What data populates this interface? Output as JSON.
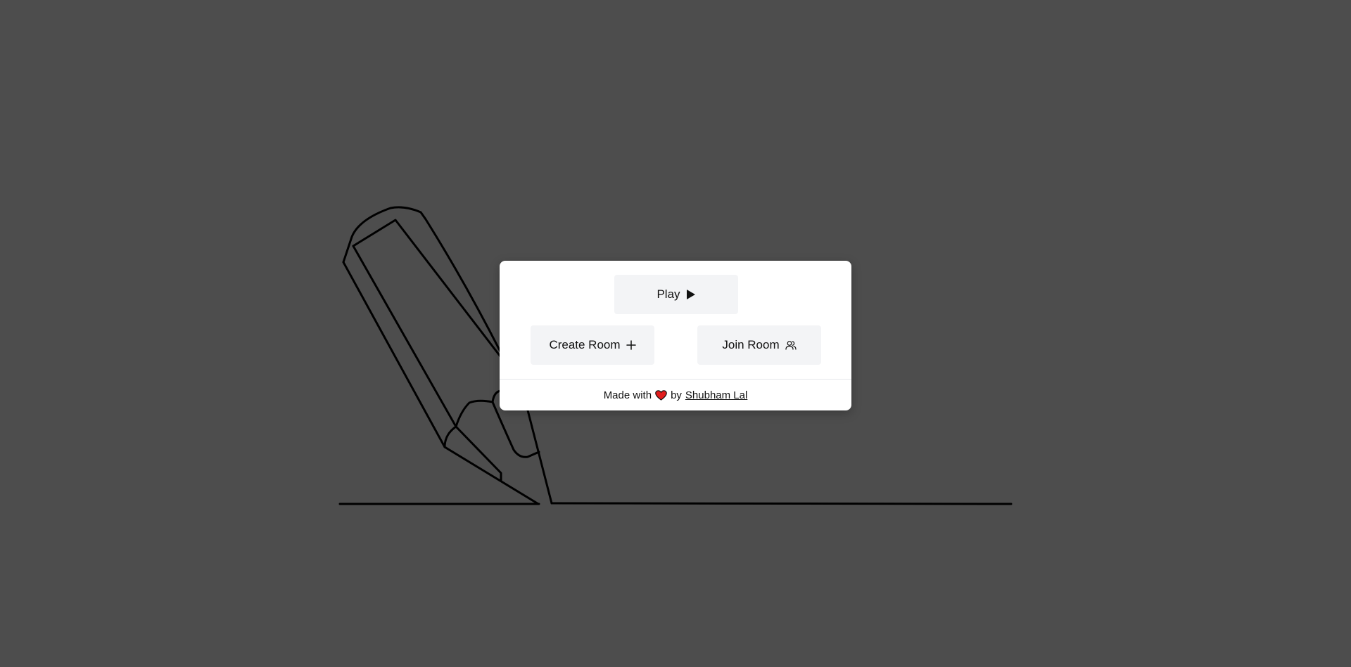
{
  "menu": {
    "play_label": "Play",
    "play_icon": "play-icon",
    "create_room_label": "Create Room",
    "create_room_icon": "plus-icon",
    "join_room_label": "Join Room",
    "join_room_icon": "users-icon"
  },
  "footer": {
    "made_with": "Made with",
    "heart_icon": "heart-icon",
    "by": "by",
    "author": "Shubham Lal"
  },
  "colors": {
    "background": "#4d4d4d",
    "card": "#ffffff",
    "button": "#f3f4f6",
    "heart": "#e11d1d",
    "line": "#000000"
  }
}
